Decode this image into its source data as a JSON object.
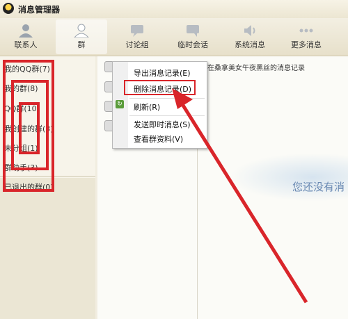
{
  "window": {
    "title": "消息管理器"
  },
  "toolbar": {
    "tabs": [
      {
        "label": "联系人"
      },
      {
        "label": "群"
      },
      {
        "label": "讨论组"
      },
      {
        "label": "临时会话"
      },
      {
        "label": "系统消息"
      },
      {
        "label": "更多消息"
      }
    ]
  },
  "sidebar": {
    "items": [
      {
        "label": "我的QQ群(7)"
      },
      {
        "label": "我的群(8)"
      },
      {
        "label": "QQ群(10)"
      },
      {
        "label": "我创建的群(3)"
      },
      {
        "label": "未分组(1)"
      },
      {
        "label": "群助手(3)"
      },
      {
        "label": "已退出的群(0)"
      }
    ]
  },
  "message_list": {
    "preview": "在桑拿美女午夜黑丝的消息记录"
  },
  "context_menu": {
    "items": [
      {
        "label": "导出消息记录(E)"
      },
      {
        "label": "删除消息记录(D)"
      },
      {
        "label": "刷新(R)"
      },
      {
        "label": "发送即时消息(S)"
      },
      {
        "label": "查看群资料(V)"
      }
    ]
  },
  "content": {
    "empty_text": "您还没有消"
  },
  "colors": {
    "annotation_red": "#d9252a",
    "empty_text_blue": "#6a8ab3"
  }
}
